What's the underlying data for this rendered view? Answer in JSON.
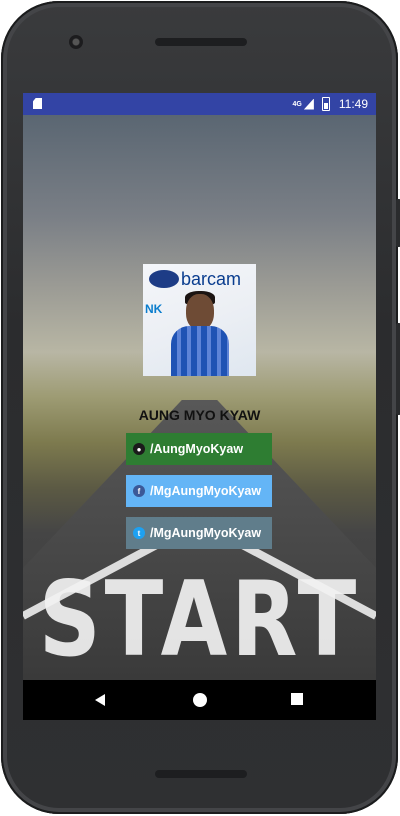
{
  "status_bar": {
    "network": "4G",
    "time": "11:49"
  },
  "profile": {
    "name": "AUNG MYO KYAW",
    "photo_logo_text": "barcam",
    "photo_sign_text": "NK"
  },
  "links": [
    {
      "label": "/AungMyoKyaw",
      "icon": "github-icon",
      "color": "#2e7d32"
    },
    {
      "label": "/MgAungMyoKyaw",
      "icon": "facebook-icon",
      "color": "#64b5f6"
    },
    {
      "label": "/MgAungMyoKyaw",
      "icon": "twitter-icon",
      "color": "#607d8b"
    }
  ],
  "background": {
    "road_text": "START"
  }
}
